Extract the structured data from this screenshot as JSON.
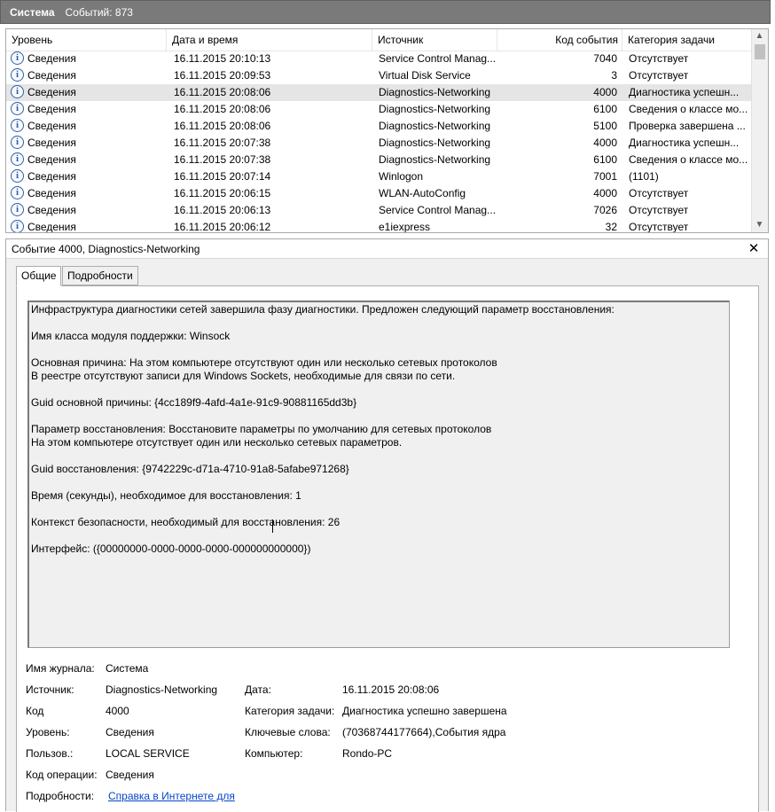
{
  "header": {
    "title": "Система",
    "count_label": "Событий: 873"
  },
  "columns": [
    "Уровень",
    "Дата и время",
    "Источник",
    "Код события",
    "Категория задачи"
  ],
  "rows": [
    {
      "level": "Сведения",
      "datetime": "16.11.2015 20:10:13",
      "source": "Service Control Manag...",
      "code": "7040",
      "category": "Отсутствует"
    },
    {
      "level": "Сведения",
      "datetime": "16.11.2015 20:09:53",
      "source": "Virtual Disk Service",
      "code": "3",
      "category": "Отсутствует"
    },
    {
      "level": "Сведения",
      "datetime": "16.11.2015 20:08:06",
      "source": "Diagnostics-Networking",
      "code": "4000",
      "category": "Диагностика успешн..."
    },
    {
      "level": "Сведения",
      "datetime": "16.11.2015 20:08:06",
      "source": "Diagnostics-Networking",
      "code": "6100",
      "category": "Сведения о классе мо..."
    },
    {
      "level": "Сведения",
      "datetime": "16.11.2015 20:08:06",
      "source": "Diagnostics-Networking",
      "code": "5100",
      "category": "Проверка завершена ..."
    },
    {
      "level": "Сведения",
      "datetime": "16.11.2015 20:07:38",
      "source": "Diagnostics-Networking",
      "code": "4000",
      "category": "Диагностика успешн..."
    },
    {
      "level": "Сведения",
      "datetime": "16.11.2015 20:07:38",
      "source": "Diagnostics-Networking",
      "code": "6100",
      "category": "Сведения о классе мо..."
    },
    {
      "level": "Сведения",
      "datetime": "16.11.2015 20:07:14",
      "source": "Winlogon",
      "code": "7001",
      "category": "(1101)"
    },
    {
      "level": "Сведения",
      "datetime": "16.11.2015 20:06:15",
      "source": "WLAN-AutoConfig",
      "code": "4000",
      "category": "Отсутствует"
    },
    {
      "level": "Сведения",
      "datetime": "16.11.2015 20:06:13",
      "source": "Service Control Manag...",
      "code": "7026",
      "category": "Отсутствует"
    },
    {
      "level": "Сведения",
      "datetime": "16.11.2015 20:06:12",
      "source": "e1iexpress",
      "code": "32",
      "category": "Отсутствует"
    }
  ],
  "selected_row": 2,
  "detail": {
    "title": "Событие 4000, Diagnostics-Networking",
    "tabs": [
      "Общие",
      "Подробности"
    ],
    "message_lines": [
      "Инфраструктура диагностики сетей завершила фазу диагностики. Предложен следующий параметр восстановления:",
      "",
      "Имя класса модуля поддержки: Winsock",
      "",
      "Основная причина: На этом компьютере отсутствуют один или несколько сетевых протоколов",
      "В реестре отсутствуют записи для Windows Sockets, необходимые для связи по сети.",
      "",
      "Guid основной причины: {4cc189f9-4afd-4a1e-91c9-90881165dd3b}",
      "",
      "Параметр восстановления: Восстановите параметры по умолчанию для сетевых протоколов",
      "На этом компьютере отсутствует один или несколько сетевых параметров.",
      "",
      "Guid восстановления: {9742229c-d71a-4710-91a8-5afabe971268}",
      "",
      "Время (секунды), необходимое для восстановления: 1",
      "",
      "Контекст безопасности, необходимый для восстановления: 26",
      "",
      "Интерфейс:  ({00000000-0000-0000-0000-000000000000})"
    ],
    "props": {
      "log_name_label": "Имя журнала:",
      "log_name": "Система",
      "source_label": "Источник:",
      "source": "Diagnostics-Networking",
      "date_label": "Дата:",
      "date": "16.11.2015 20:08:06",
      "code_label": "Код",
      "code": "4000",
      "task_label": "Категория задачи:",
      "task": "Диагностика успешно завершена",
      "level_label": "Уровень:",
      "level": "Сведения",
      "keywords_label": "Ключевые слова:",
      "keywords": "(70368744177664),События ядра",
      "user_label": "Пользов.:",
      "user": "LOCAL SERVICE",
      "computer_label": "Компьютер:",
      "computer": "Rondo-PC",
      "opcode_label": "Код операции:",
      "opcode": "Сведения",
      "more_label": "Подробности:",
      "more_link": "Справка в Интернете для "
    }
  }
}
